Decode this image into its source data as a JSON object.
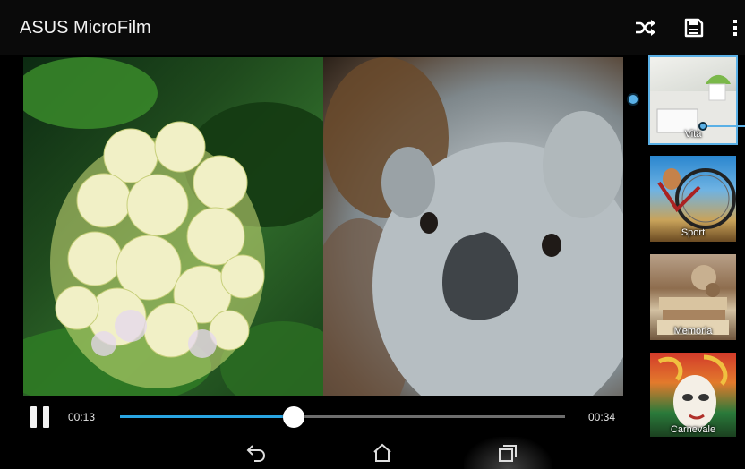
{
  "app": {
    "title": "ASUS MicroFilm"
  },
  "toolbar": {
    "icons": [
      "shuffle-icon",
      "save-icon",
      "more-vertical-icon"
    ]
  },
  "player": {
    "current_time": "00:13",
    "total_time": "00:34",
    "progress_fraction": 0.39,
    "accent_color": "#29a5e3"
  },
  "themes": [
    {
      "label": "Vita",
      "selected": true
    },
    {
      "label": "Sport",
      "selected": false
    },
    {
      "label": "Memoria",
      "selected": false
    },
    {
      "label": "Carnevale",
      "selected": false
    }
  ],
  "navigation": {
    "icons": [
      "back-icon",
      "home-icon",
      "recent-apps-icon"
    ]
  }
}
